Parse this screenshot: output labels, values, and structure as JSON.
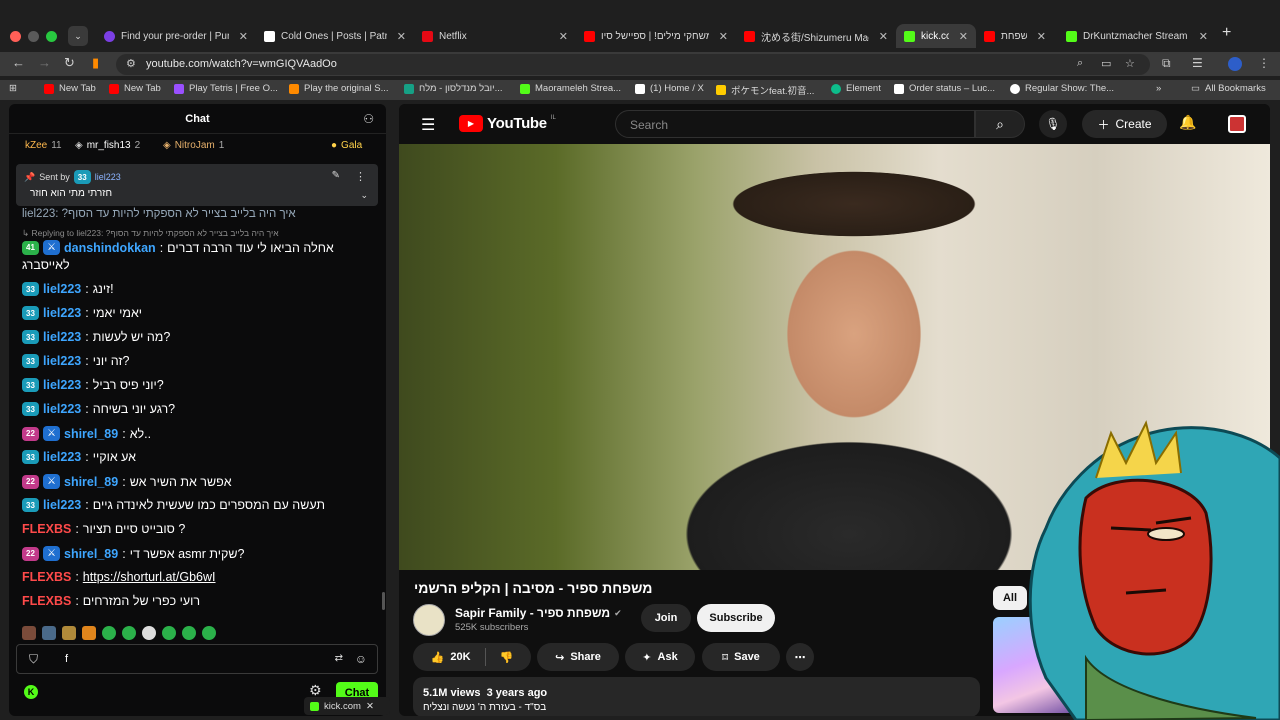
{
  "browser": {
    "tabs": [
      {
        "label": "Find your pre-order | Pur",
        "color": "#7b3fe4"
      },
      {
        "label": "Cold Ones | Posts | Patreo",
        "color": "#ffffff"
      },
      {
        "label": "Netflix",
        "color": "#e50914"
      },
      {
        "label": "משחקי מילים! | ספיישל סיו",
        "color": "#ff0000"
      },
      {
        "label": "沈める街/Shizumeru Machi",
        "color": "#ff0000"
      },
      {
        "label": "kick.co",
        "color": "#53fc18"
      },
      {
        "label": "משפחת",
        "color": "#ff0000"
      },
      {
        "label": "DrKuntzmacher Stream",
        "color": "#53fc18"
      }
    ],
    "tab_close": "✕",
    "new_tab": "+",
    "url": "youtube.com/watch?v=wmGIQVAadOo",
    "bookmarks": [
      {
        "label": "New Tab",
        "color": "#ff0000"
      },
      {
        "label": "New Tab",
        "color": "#ff0000"
      },
      {
        "label": "Play Tetris | Free O...",
        "color": "#9a50ff"
      },
      {
        "label": "Play the original S...",
        "color": "#ff8a00"
      },
      {
        "label": "יובל מנדלסון - מלח...",
        "color": "#16a085"
      },
      {
        "label": "Maorameleh Strea...",
        "color": "#53fc18"
      },
      {
        "label": "(1) Home / X",
        "color": "#ffffff"
      },
      {
        "label": "ポケモンfeat.初音...",
        "color": "#ffcc00"
      },
      {
        "label": "Element",
        "color": "#0dbd8b"
      },
      {
        "label": "Order status – Luc...",
        "color": "#ffffff"
      },
      {
        "label": "Regular Show: The...",
        "color": "#ffffff"
      }
    ],
    "all_bookmarks": "All Bookmarks"
  },
  "chat": {
    "title": "Chat",
    "leaderboard": [
      {
        "name": "kZee",
        "count": "11"
      },
      {
        "name": "mr_fish13",
        "count": "2"
      },
      {
        "name": "NitroJam",
        "count": "1"
      },
      {
        "name": "Gala",
        "count": ""
      }
    ],
    "pinned": {
      "sent_by_label": "Sent by",
      "badge": "33",
      "user": "liel223",
      "message": "חזרתי מתי הוא חוזר"
    },
    "partial_top": "liel223: ?איך היה בלייב בצייר לא הספקתי להיות עד הסוף",
    "reply_to": "↳ Replying to liel223: ?איך היה בלייב בצייר לא הספקתי להיות עד הסוף",
    "messages": [
      {
        "badge": "41",
        "user": "danshindokkan",
        "text": "אחלה הביאו לי עוד הרבה דברים",
        "color": "#3ea6ff"
      },
      {
        "badge": "",
        "user": "",
        "text": "לאייסברג",
        "color": "#ffffff"
      },
      {
        "badge": "33",
        "user": "liel223",
        "text": "!זינג",
        "color": "#3ea6ff"
      },
      {
        "badge": "33",
        "user": "liel223",
        "text": "יאמי יאמי",
        "color": "#3ea6ff"
      },
      {
        "badge": "33",
        "user": "liel223",
        "text": "?מה יש לעשות",
        "color": "#3ea6ff"
      },
      {
        "badge": "33",
        "user": "liel223",
        "text": "?זה יוני",
        "color": "#3ea6ff"
      },
      {
        "badge": "33",
        "user": "liel223",
        "text": "?יוני פיס רביל",
        "color": "#3ea6ff"
      },
      {
        "badge": "33",
        "user": "liel223",
        "text": "?רגע יוני בשיחה",
        "color": "#3ea6ff"
      },
      {
        "badge": "22",
        "user": "shirel_89",
        "text": "..לא",
        "color": "#3ea6ff"
      },
      {
        "badge": "33",
        "user": "liel223",
        "text": "אע אוקיי",
        "color": "#3ea6ff"
      },
      {
        "badge": "22",
        "user": "shirel_89",
        "text": "אפשר את השיר אש",
        "color": "#3ea6ff"
      },
      {
        "badge": "33",
        "user": "liel223",
        "text": "תעשה עם המספרים כמו שעשית לאינדה גיים",
        "color": "#3ea6ff"
      },
      {
        "badge": "",
        "user": "FLEXBS",
        "text": "? סובייט סיים תציור",
        "color": "#ff4a4a"
      },
      {
        "badge": "22",
        "user": "shirel_89",
        "text": "?שקית asmr אפשר די",
        "color": "#3ea6ff"
      },
      {
        "badge": "",
        "user": "FLEXBS",
        "text": "https://shorturl.at/Gb6wI",
        "color": "#ff4a4a"
      },
      {
        "badge": "",
        "user": "FLEXBS",
        "text": "רועי כפרי של המזרחים",
        "color": "#ff4a4a"
      }
    ],
    "input_value": "f",
    "send_label": "Chat"
  },
  "youtube": {
    "logo_text": "YouTube",
    "country": "IL",
    "search_placeholder": "Search",
    "create_label": "Create",
    "video_title": "משפחת ספיר - מסיבה | הקליפ הרשמי",
    "channel_name": "Sapir Family - משפחת ספיר",
    "subscribers": "525K subscribers",
    "join_label": "Join",
    "subscribe_label": "Subscribe",
    "likes": "20K",
    "share_label": "Share",
    "ask_label": "Ask",
    "save_label": "Save",
    "views": "5.1M views",
    "age": "3 years ago",
    "description_line": "בס\"ד - בעזרת ה' נעשה ונצליח",
    "chip_all": "All"
  },
  "taskbar": {
    "mini_tab": "kick.com"
  },
  "colors": {
    "kick_green": "#53fc18",
    "yt_red": "#ff0000",
    "panel_bg": "#0b0b0c"
  }
}
